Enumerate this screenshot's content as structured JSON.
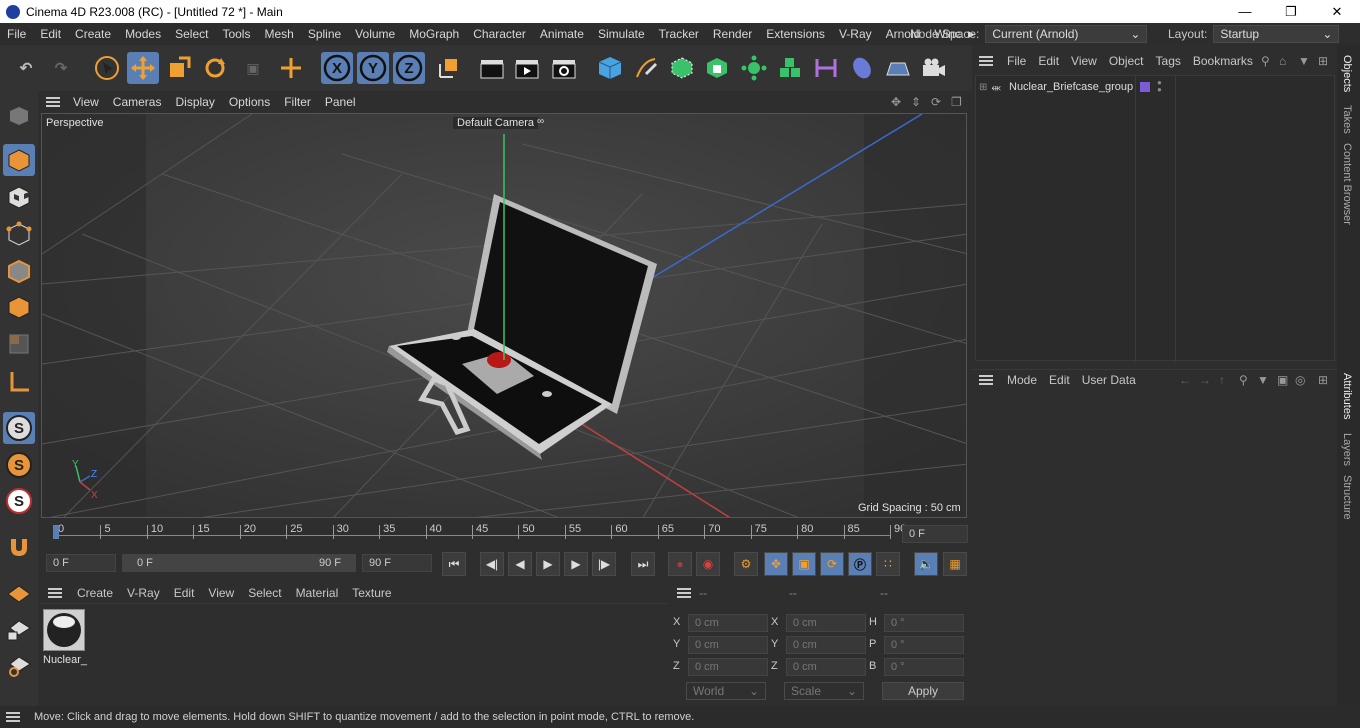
{
  "window": {
    "title": "Cinema 4D R23.008 (RC) - [Untitled 72 *] - Main"
  },
  "menubar": {
    "items": [
      "File",
      "Edit",
      "Create",
      "Modes",
      "Select",
      "Tools",
      "Mesh",
      "Spline",
      "Volume",
      "MoGraph",
      "Character",
      "Animate",
      "Simulate",
      "Tracker",
      "Render",
      "Extensions",
      "V-Ray",
      "Arnold",
      "Winc"
    ]
  },
  "nodespace": {
    "label": "Node Space:",
    "value": "Current (Arnold)"
  },
  "layout": {
    "label": "Layout:",
    "value": "Startup"
  },
  "viewport": {
    "menu": [
      "View",
      "Cameras",
      "Display",
      "Options",
      "Filter",
      "Panel"
    ],
    "view_name": "Perspective",
    "camera": "Default Camera",
    "grid_spacing": "Grid Spacing : 50 cm",
    "axes": {
      "x": "X",
      "y": "Y",
      "z": "Z"
    }
  },
  "objects_panel": {
    "menu": [
      "File",
      "Edit",
      "View",
      "Object",
      "Tags",
      "Bookmarks"
    ],
    "items": [
      {
        "name": "Nuclear_Briefcase_group"
      }
    ]
  },
  "attributes_panel": {
    "menu": [
      "Mode",
      "Edit",
      "User Data"
    ]
  },
  "side_tabs": [
    "Objects",
    "Takes",
    "Content Browser",
    "Attributes",
    "Layers",
    "Structure"
  ],
  "timeline": {
    "ticks": [
      "0",
      "5",
      "10",
      "15",
      "20",
      "25",
      "30",
      "35",
      "40",
      "45",
      "50",
      "55",
      "60",
      "65",
      "70",
      "75",
      "80",
      "85",
      "90"
    ],
    "current": "0 F"
  },
  "controls": {
    "start": "0 F",
    "range_start": "0 F",
    "range_end": "90 F",
    "end": "90 F"
  },
  "material_panel": {
    "menu": [
      "Create",
      "V-Ray",
      "Edit",
      "View",
      "Select",
      "Material",
      "Texture"
    ],
    "material_label": "Nuclear_"
  },
  "coord_panel": {
    "headers": [
      "--",
      "--",
      "--"
    ],
    "rows": [
      {
        "a": "X",
        "av": "0 cm",
        "b": "X",
        "bv": "0 cm",
        "c": "H",
        "cv": "0 °"
      },
      {
        "a": "Y",
        "av": "0 cm",
        "b": "Y",
        "bv": "0 cm",
        "c": "P",
        "cv": "0 °"
      },
      {
        "a": "Z",
        "av": "0 cm",
        "b": "Z",
        "bv": "0 cm",
        "c": "B",
        "cv": "0 °"
      }
    ],
    "world": "World",
    "scale": "Scale",
    "apply": "Apply"
  },
  "status": {
    "text": "Move: Click and drag to move elements. Hold down SHIFT to quantize movement / add to the selection in point mode, CTRL to remove."
  },
  "colors": {
    "accent": "#5a7fb5",
    "orange": "#f0a030",
    "group_tag": "#7b5cd6"
  }
}
